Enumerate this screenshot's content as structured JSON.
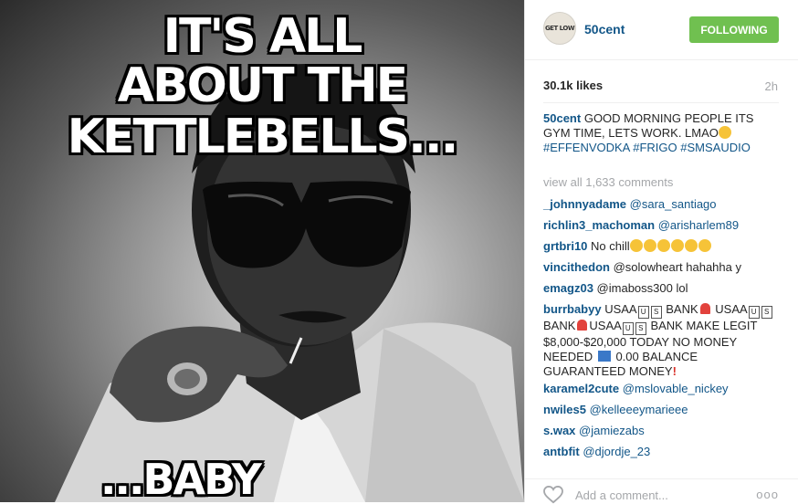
{
  "photo": {
    "meme_line1": "IT'S ALL",
    "meme_line2": "ABOUT THE KETTLEBELLS...",
    "meme_line3": "...BABY"
  },
  "header": {
    "avatar_text": "GET LOW",
    "username": "50cent",
    "follow_label": "FOLLOWING"
  },
  "stats": {
    "likes": "30.1k likes",
    "time": "2h"
  },
  "caption": {
    "username": "50cent",
    "text": "GOOD MORNING PEOPLE ITS GYM TIME, LETS WORK. LMAO",
    "hashtags": "#EFFENVODKA #FRIGO #SMSAUDIO"
  },
  "view_all": "view all 1,633 comments",
  "comments": [
    {
      "user": "_johnnyadame",
      "text": "@sara_santiago"
    },
    {
      "user": "richlin3_machoman",
      "text": "@arisharlem89"
    },
    {
      "user": "grtbri10",
      "text": "No chill"
    },
    {
      "user": "vincithedon",
      "text": "@solowheart hahahha y"
    },
    {
      "user": "emagz03",
      "text": "@imaboss300 lol"
    },
    {
      "user": "burrbabyy",
      "text_a": "USAA",
      "text_b": "BANK",
      "text_c": "USAA",
      "text_d": "BANK",
      "text_e": "USAA",
      "text_f": "BANK MAKE LEGIT $8,000-$20,000 TODAY NO MONEY NEEDED",
      "text_g": "0.00 BALANCE GUARANTEED MONEY"
    },
    {
      "user": "karamel2cute",
      "text": "@mslovable_nickey"
    },
    {
      "user": "nwiles5",
      "text": "@kelleeeymarieee"
    },
    {
      "user": "s.wax",
      "text": "@jamiezabs"
    },
    {
      "user": "antbfit",
      "text": "@djordje_23"
    }
  ],
  "footer": {
    "add_comment_placeholder": "Add a comment...",
    "more_label": "ooo"
  },
  "colors": {
    "link_blue": "#125688",
    "follow_green": "#70c050",
    "muted_gray": "#a5a7aa"
  }
}
